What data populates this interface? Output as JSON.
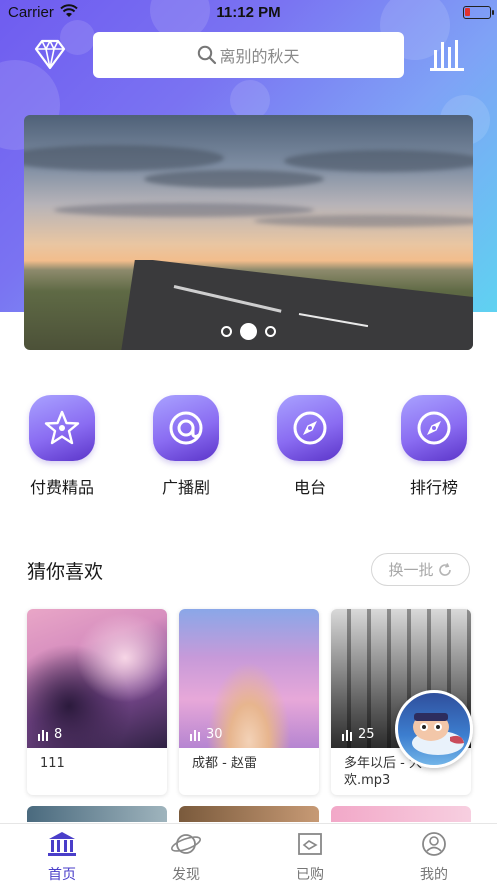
{
  "status_bar": {
    "carrier": "Carrier",
    "time": "11:12 PM"
  },
  "header": {
    "search_placeholder": "离别的秋天"
  },
  "banner": {
    "slide_count": 3,
    "active_slide": 2
  },
  "categories": [
    {
      "label": "付费精品",
      "icon": "star-icon"
    },
    {
      "label": "广播剧",
      "icon": "at-sign-icon"
    },
    {
      "label": "电台",
      "icon": "compass-icon"
    },
    {
      "label": "排行榜",
      "icon": "compass-icon"
    }
  ],
  "recommend": {
    "title": "猜你喜欢",
    "refresh_label": "换一批",
    "cards": [
      {
        "stat": "8",
        "title": "111"
      },
      {
        "stat": "30",
        "title": "成都 - 赵雷"
      },
      {
        "stat": "25",
        "title": "多年以后 - 大\n欢.mp3"
      }
    ]
  },
  "tabbar": {
    "items": [
      {
        "label": "首页",
        "icon": "home-icon",
        "active": true
      },
      {
        "label": "发现",
        "icon": "planet-icon",
        "active": false
      },
      {
        "label": "已购",
        "icon": "purchased-icon",
        "active": false
      },
      {
        "label": "我的",
        "icon": "user-icon",
        "active": false
      }
    ]
  },
  "colors": {
    "accent": "#4a3ec9",
    "category_icon": "#8a6cf2",
    "battery_low": "#e0322f"
  }
}
